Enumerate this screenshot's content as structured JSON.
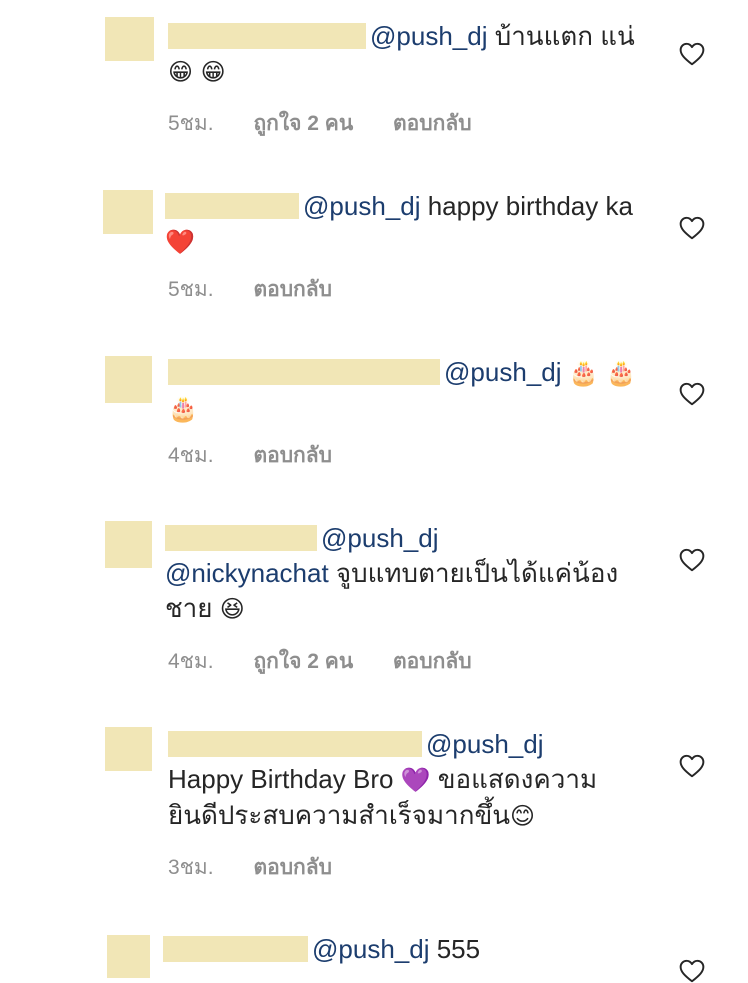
{
  "comments": [
    {
      "mention": "@push_dj",
      "text": " บ้านแตก แน่",
      "emoji": "😁 😁",
      "time": "5ชม.",
      "likes": "ถูกใจ 2 คน",
      "reply": "ตอบกลับ"
    },
    {
      "mention": "@push_dj",
      "text": " happy birthday ka",
      "emoji": "❤️",
      "time": "5ชม.",
      "reply": "ตอบกลับ"
    },
    {
      "mention": "@push_dj",
      "text": " ",
      "emoji": "🎂 🎂 🎂",
      "time": "4ชม.",
      "reply": "ตอบกลับ"
    },
    {
      "mention": "@push_dj",
      "mention2": "@nickynachat",
      "text": "  จูบแทบตายเป็นได้แค่น้องชาย ",
      "emoji": "😆",
      "time": "4ชม.",
      "likes": "ถูกใจ 2 คน",
      "reply": "ตอบกลับ"
    },
    {
      "mention": "@push_dj",
      "text": "Happy Birthday Bro ",
      "emoji_mid": "💜",
      "text2": " ขอแสดงความยินดีประสบความสำเร็จมากขึ้น",
      "emoji": "😊",
      "time": "3ชม.",
      "reply": "ตอบกลับ"
    },
    {
      "mention": "@push_dj",
      "text": " 555"
    }
  ],
  "icons": {
    "like": "heart-outline-icon"
  },
  "colors": {
    "mention": "#1c3d6e",
    "meta": "#8e8e8e",
    "redaction": "#f1e6b6"
  }
}
